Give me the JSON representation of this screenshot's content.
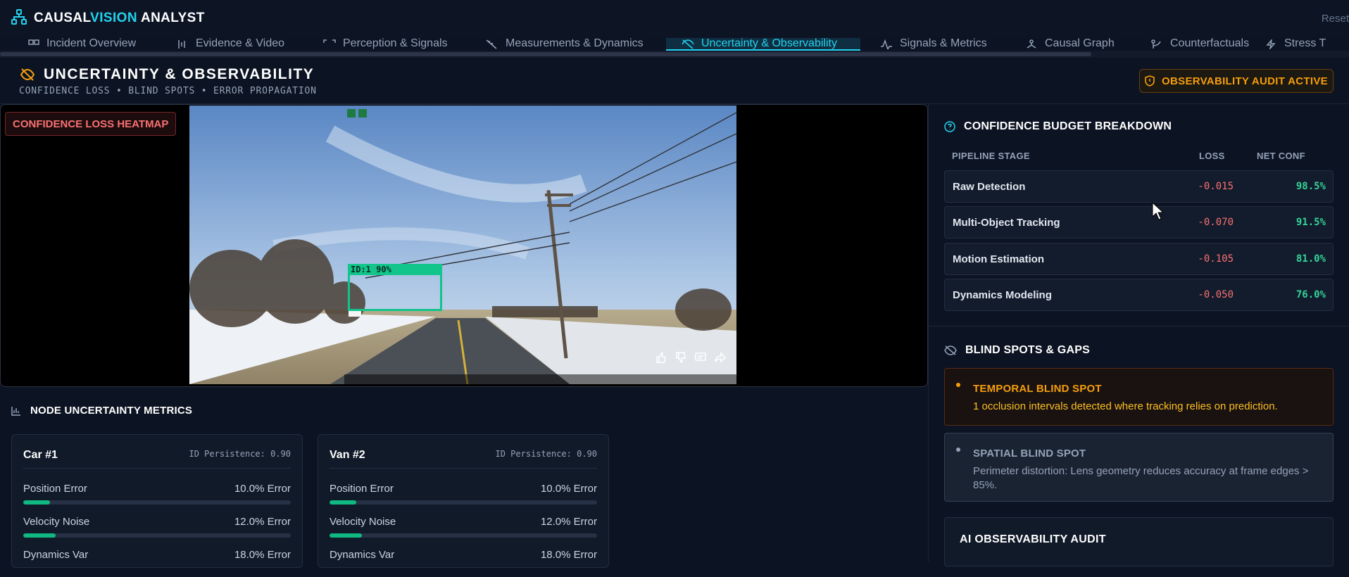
{
  "app": {
    "brand_a": "CAUSAL",
    "brand_b": "VISION",
    "brand_c": " ANALYST",
    "reset": "Reset"
  },
  "tabs": [
    {
      "label": "Incident Overview",
      "icon": "layout-icon"
    },
    {
      "label": "Evidence & Video",
      "icon": "video-icon"
    },
    {
      "label": "Perception & Signals",
      "icon": "scan-icon"
    },
    {
      "label": "Measurements & Dynamics",
      "icon": "ruler-icon"
    },
    {
      "label": "Uncertainty & Observability",
      "icon": "eye-off-icon",
      "active": true
    },
    {
      "label": "Signals & Metrics",
      "icon": "activity-icon"
    },
    {
      "label": "Causal Graph",
      "icon": "network-icon"
    },
    {
      "label": "Counterfactuals",
      "icon": "branch-icon"
    },
    {
      "label": "Stress T",
      "icon": "zap-icon"
    }
  ],
  "header": {
    "title": "UNCERTAINTY & OBSERVABILITY",
    "subtitle": "CONFIDENCE LOSS • BLIND SPOTS • ERROR PROPAGATION",
    "badge": "OBSERVABILITY AUDIT ACTIVE"
  },
  "video": {
    "overlay_label": "CONFIDENCE LOSS HEATMAP",
    "detection_label": "ID:1 90%",
    "icons": [
      "thumbs-up-icon",
      "thumbs-down-icon",
      "comment-icon",
      "share-icon"
    ]
  },
  "budget": {
    "title": "CONFIDENCE BUDGET BREAKDOWN",
    "columns": [
      "PIPELINE STAGE",
      "LOSS",
      "NET CONF"
    ],
    "rows": [
      {
        "stage": "Raw Detection",
        "loss": "-0.015",
        "net": "98.5%"
      },
      {
        "stage": "Multi-Object Tracking",
        "loss": "-0.070",
        "net": "91.5%"
      },
      {
        "stage": "Motion Estimation",
        "loss": "-0.105",
        "net": "81.0%"
      },
      {
        "stage": "Dynamics Modeling",
        "loss": "-0.050",
        "net": "76.0%"
      }
    ]
  },
  "blind_spots": {
    "title": "BLIND SPOTS & GAPS",
    "items": [
      {
        "title": "TEMPORAL BLIND SPOT",
        "desc": "1 occlusion intervals detected where tracking relies on prediction.",
        "color": "#f59e0b"
      },
      {
        "title": "SPATIAL BLIND SPOT",
        "desc": "Perimeter distortion: Lens geometry reduces accuracy at frame edges > 85%.",
        "color": "#94a3b8"
      }
    ]
  },
  "ai_audit": {
    "title": "AI OBSERVABILITY AUDIT"
  },
  "nodes": {
    "title": "NODE UNCERTAINTY METRICS",
    "cards": [
      {
        "name": "Car #1",
        "id_persistence": "ID Persistence: 0.90",
        "metrics": [
          {
            "label": "Position Error",
            "value": "10.0% Error",
            "fraction": 0.1
          },
          {
            "label": "Velocity Noise",
            "value": "12.0% Error",
            "fraction": 0.12
          },
          {
            "label": "Dynamics Var",
            "value": "18.0% Error",
            "fraction": 0.18
          }
        ]
      },
      {
        "name": "Van #2",
        "id_persistence": "ID Persistence: 0.90",
        "metrics": [
          {
            "label": "Position Error",
            "value": "10.0% Error",
            "fraction": 0.1
          },
          {
            "label": "Velocity Noise",
            "value": "12.0% Error",
            "fraction": 0.12
          },
          {
            "label": "Dynamics Var",
            "value": "18.0% Error",
            "fraction": 0.18
          }
        ]
      }
    ]
  }
}
